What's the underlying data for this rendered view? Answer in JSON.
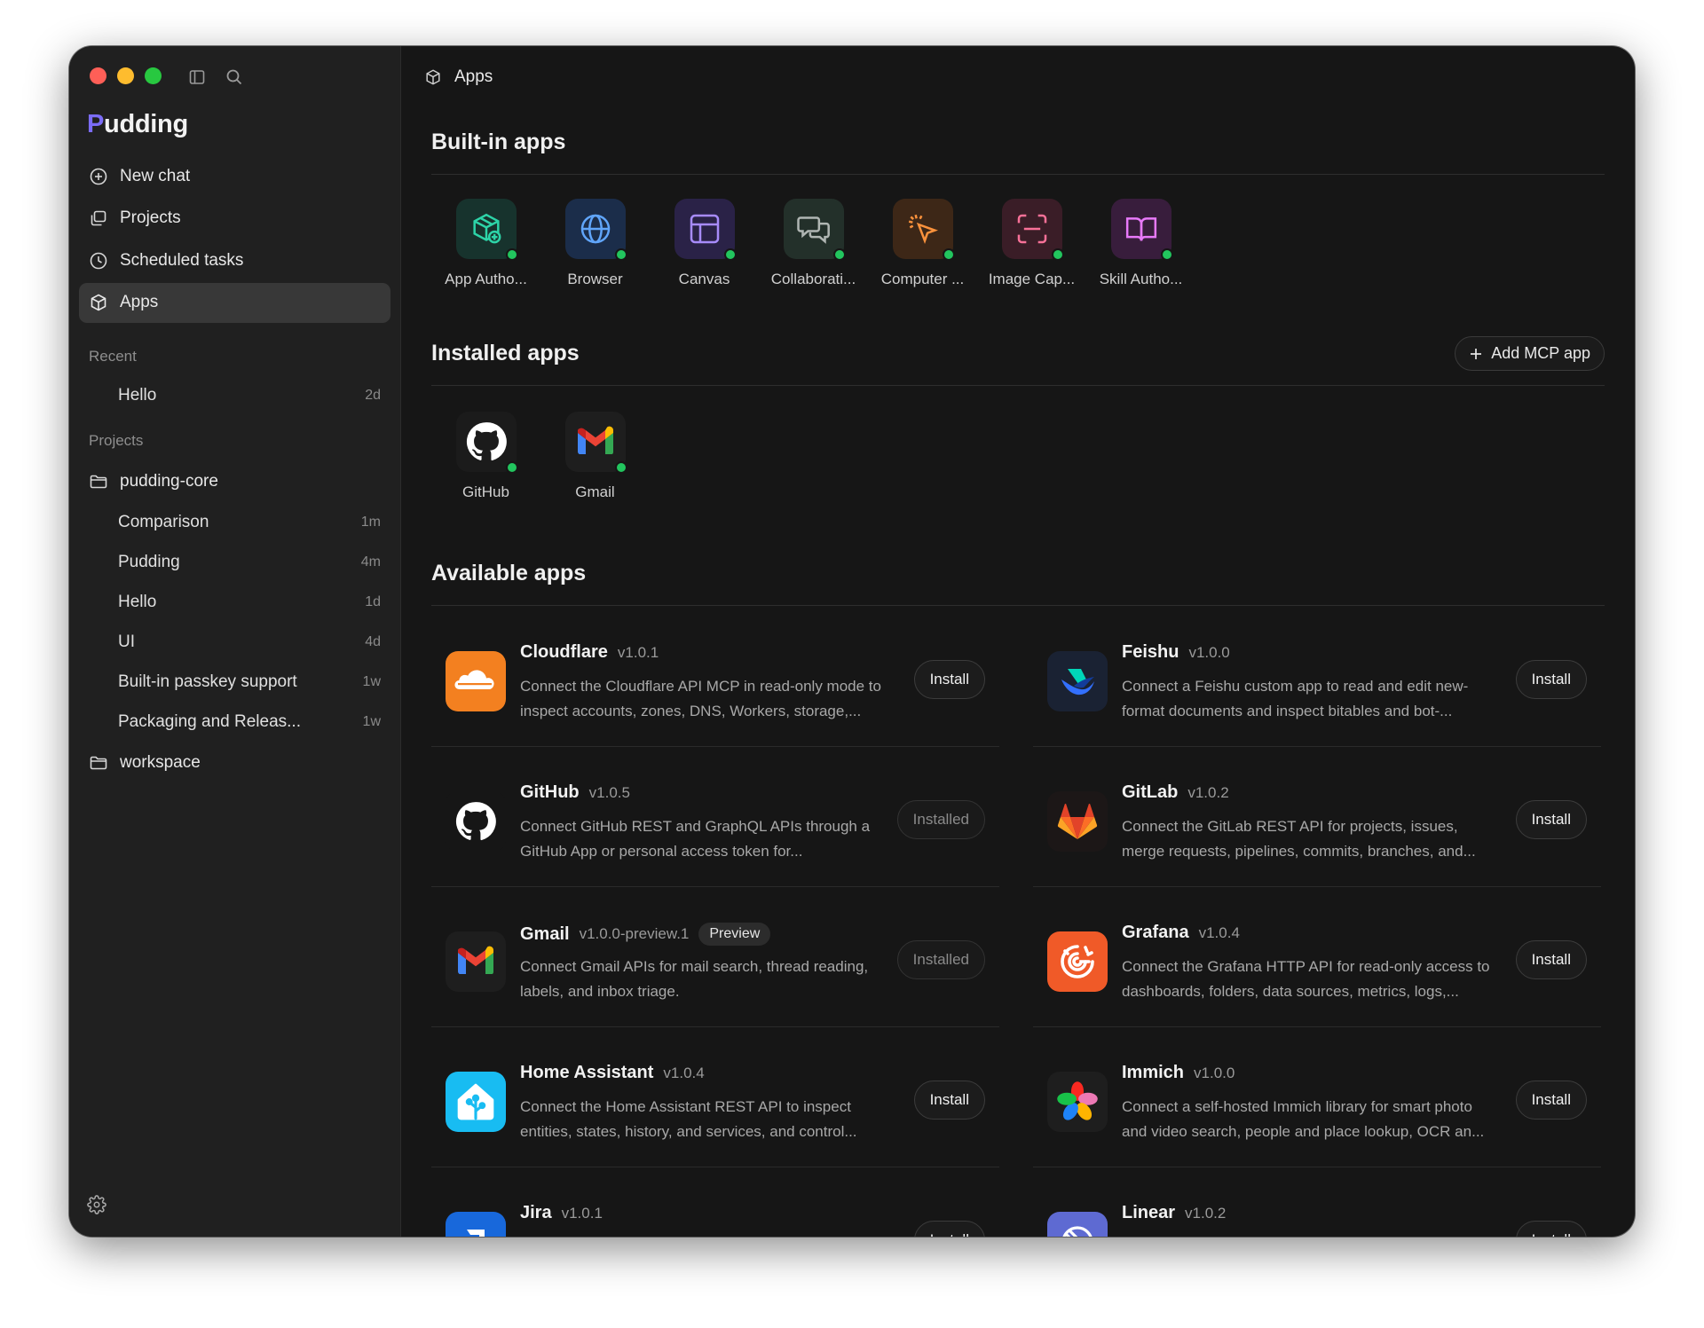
{
  "window": {
    "brand_initial": "P",
    "brand_rest": "udding"
  },
  "sidebar": {
    "nav": [
      {
        "label": "New chat",
        "icon": "plus-circle-icon"
      },
      {
        "label": "Projects",
        "icon": "projects-icon"
      },
      {
        "label": "Scheduled tasks",
        "icon": "clock-icon"
      },
      {
        "label": "Apps",
        "icon": "cube-icon",
        "active": true
      }
    ],
    "recent_label": "Recent",
    "recent": [
      {
        "label": "Hello",
        "age": "2d"
      }
    ],
    "projects_label": "Projects",
    "projects": [
      {
        "name": "pudding-core",
        "items": [
          {
            "label": "Comparison",
            "age": "1m"
          },
          {
            "label": "Pudding",
            "age": "4m"
          },
          {
            "label": "Hello",
            "age": "1d"
          },
          {
            "label": "UI",
            "age": "4d"
          },
          {
            "label": "Built-in passkey support",
            "age": "1w"
          },
          {
            "label": "Packaging and Releas...",
            "age": "1w"
          }
        ]
      },
      {
        "name": "workspace",
        "items": []
      }
    ]
  },
  "header": {
    "title": "Apps"
  },
  "builtin": {
    "title": "Built-in apps",
    "apps": [
      {
        "label": "App Autho...",
        "icon": "package-plus-icon",
        "color": "#2dd4a8"
      },
      {
        "label": "Browser",
        "icon": "globe-icon",
        "color": "#60a5fa"
      },
      {
        "label": "Canvas",
        "icon": "layout-icon",
        "color": "#a78bfa"
      },
      {
        "label": "Collaborati...",
        "icon": "chat-bubbles-icon",
        "color": "#9ca3af"
      },
      {
        "label": "Computer ...",
        "icon": "cursor-click-icon",
        "color": "#fb923c"
      },
      {
        "label": "Image Cap...",
        "icon": "scan-icon",
        "color": "#f87198"
      },
      {
        "label": "Skill Autho...",
        "icon": "book-open-icon",
        "color": "#e879f9"
      }
    ]
  },
  "installed": {
    "title": "Installed apps",
    "add_button": "Add MCP app",
    "apps": [
      {
        "label": "GitHub",
        "icon": "github-icon"
      },
      {
        "label": "Gmail",
        "icon": "gmail-icon"
      }
    ]
  },
  "available": {
    "title": "Available apps",
    "install_label": "Install",
    "installed_label": "Installed",
    "apps": [
      {
        "name": "Cloudflare",
        "version": "v1.0.1",
        "desc": "Connect the Cloudflare API MCP in read-only mode to inspect accounts, zones, DNS, Workers, storage,...",
        "status": "Install",
        "icon": "cloudflare-icon"
      },
      {
        "name": "Feishu",
        "version": "v1.0.0",
        "desc": "Connect a Feishu custom app to read and edit new-format documents and inspect bitables and bot-...",
        "status": "Install",
        "icon": "feishu-icon"
      },
      {
        "name": "GitHub",
        "version": "v1.0.5",
        "desc": "Connect GitHub REST and GraphQL APIs through a GitHub App or personal access token for...",
        "status": "Installed",
        "icon": "github-icon"
      },
      {
        "name": "GitLab",
        "version": "v1.0.2",
        "desc": "Connect the GitLab REST API for projects, issues, merge requests, pipelines, commits, branches, and...",
        "status": "Install",
        "icon": "gitlab-icon"
      },
      {
        "name": "Gmail",
        "version": "v1.0.0-preview.1",
        "badge": "Preview",
        "desc": "Connect Gmail APIs for mail search, thread reading, labels, and inbox triage.",
        "status": "Installed",
        "icon": "gmail-icon"
      },
      {
        "name": "Grafana",
        "version": "v1.0.4",
        "desc": "Connect the Grafana HTTP API for read-only access to dashboards, folders, data sources, metrics, logs,...",
        "status": "Install",
        "icon": "grafana-icon"
      },
      {
        "name": "Home Assistant",
        "version": "v1.0.4",
        "desc": "Connect the Home Assistant REST API to inspect entities, states, history, and services, and control...",
        "status": "Install",
        "icon": "home-assistant-icon"
      },
      {
        "name": "Immich",
        "version": "v1.0.0",
        "desc": "Connect a self-hosted Immich library for smart photo and video search, people and place lookup, OCR an...",
        "status": "Install",
        "icon": "immich-icon"
      },
      {
        "name": "Jira",
        "version": "v1.0.1",
        "desc": "",
        "status": "Install",
        "icon": "jira-icon"
      },
      {
        "name": "Linear",
        "version": "v1.0.2",
        "desc": "",
        "status": "Install",
        "icon": "linear-icon"
      }
    ]
  }
}
